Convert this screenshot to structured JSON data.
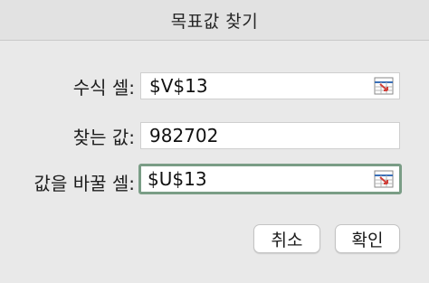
{
  "dialog": {
    "title": "목표값 찾기"
  },
  "fields": {
    "set_cell": {
      "label": "수식 셀:",
      "value": "$V$13",
      "icon": "cell-range-select-icon"
    },
    "to_value": {
      "label": "찾는 값:",
      "value": "982702"
    },
    "by_changing_cell": {
      "label": "값을 바꿀 셀:",
      "value": "$U$13",
      "icon": "cell-range-select-icon"
    }
  },
  "buttons": {
    "cancel": "취소",
    "ok": "확인"
  },
  "colors": {
    "focus_ring": "#7a9d86",
    "ref_icon_red": "#d0403a",
    "ref_icon_blue": "#3a6fb7"
  }
}
